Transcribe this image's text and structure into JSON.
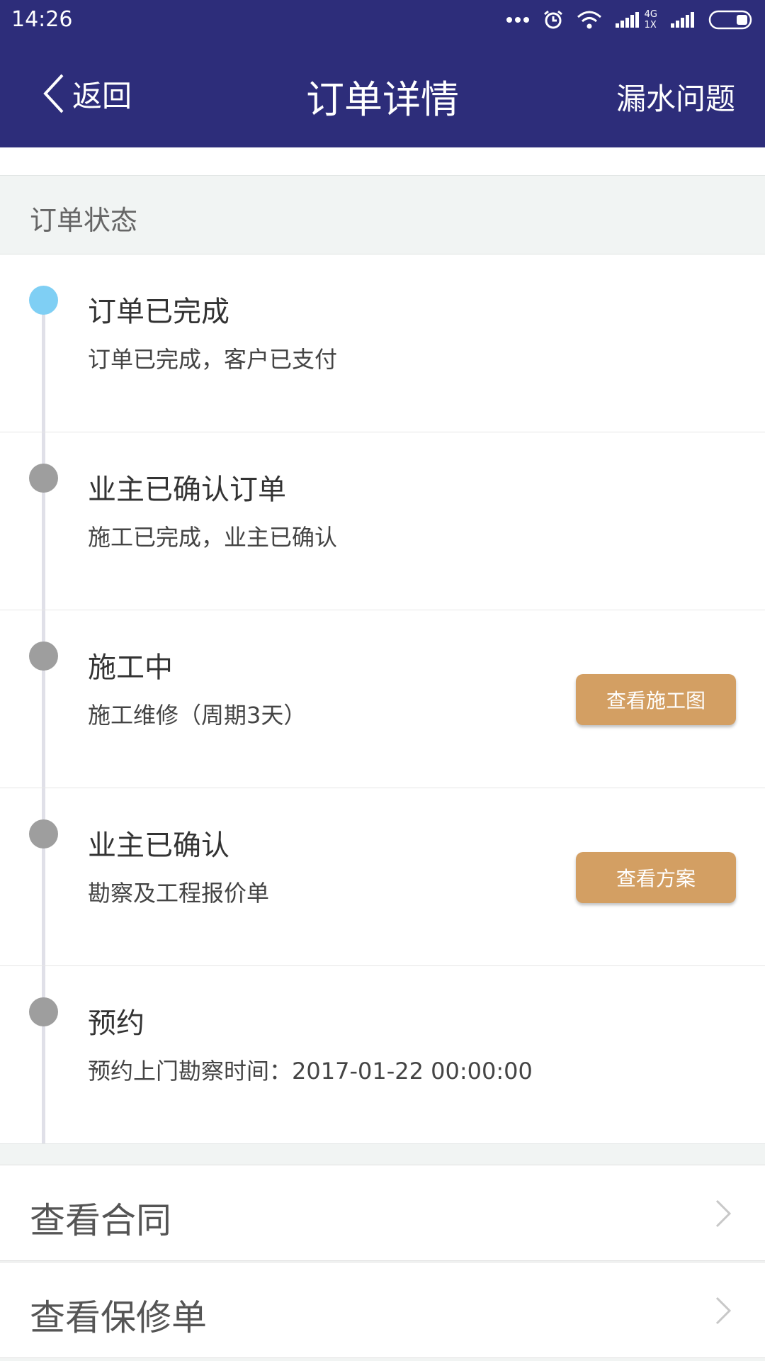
{
  "status_bar": {
    "time": "14:26",
    "network_label": "4G",
    "network_sub": "1X"
  },
  "nav": {
    "back_label": "返回",
    "title": "订单详情",
    "right_label": "漏水问题"
  },
  "section": {
    "title": "订单状态"
  },
  "timeline": [
    {
      "title": "订单已完成",
      "desc": "订单已完成，客户已支付",
      "active": true
    },
    {
      "title": "业主已确认订单",
      "desc": "施工已完成，业主已确认",
      "active": false
    },
    {
      "title": "施工中",
      "desc": "施工维修（周期3天）",
      "button": "查看施工图",
      "active": false
    },
    {
      "title": "业主已确认",
      "desc": "勘察及工程报价单",
      "button": "查看方案",
      "active": false
    },
    {
      "title": "预约",
      "desc": "预约上门勘察时间：2017-01-22 00:00:00",
      "active": false
    }
  ],
  "links": [
    {
      "label": "查看合同"
    },
    {
      "label": "查看保修单"
    }
  ],
  "colors": {
    "nav_bg": "#2d2d7a",
    "accent_button": "#d39f63",
    "active_dot": "#7fcff4",
    "dot": "#9e9e9e"
  }
}
